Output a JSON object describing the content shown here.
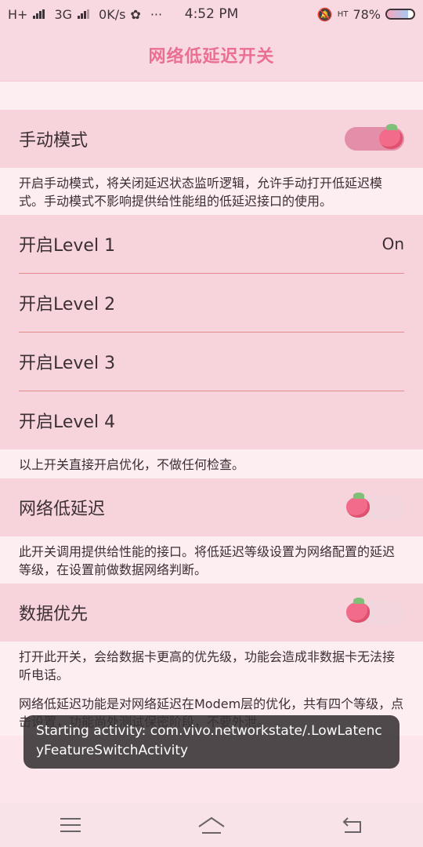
{
  "status": {
    "network": "H+",
    "network2": "3G",
    "speed": "0K/s",
    "more": "···",
    "time": "4:52 PM",
    "hd": "HT",
    "battery": "78%",
    "battery_level": 0.78
  },
  "title": "网络低延迟开关",
  "manual": {
    "label": "手动模式",
    "desc": "开启手动模式，将关闭延迟状态监听逻辑，允许手动打开低延迟模式。手动模式不影响提供给性能组的低延迟接口的使用。"
  },
  "levels": [
    {
      "label": "开启Level 1",
      "value": "On"
    },
    {
      "label": "开启Level 2",
      "value": ""
    },
    {
      "label": "开启Level 3",
      "value": ""
    },
    {
      "label": "开启Level 4",
      "value": ""
    }
  ],
  "levels_desc": "以上开关直接开启优化，不做任何检查。",
  "low_latency": {
    "label": "网络低延迟",
    "desc": "此开关调用提供给性能的接口。将低延迟等级设置为网络配置的延迟等级，在设置前做数据网络判断。"
  },
  "data_priority": {
    "label": "数据优先",
    "desc": "打开此开关，会给数据卡更高的优先级，功能会造成非数据卡无法接听电话。"
  },
  "footer_desc": "网络低延迟功能是对网络延迟在Modem层的优化，共有四个等级，点击设置，功能尚处测试保密阶段，不要外泄。",
  "toast": "Starting activity: com.vivo.networkstate/.LowLatencyFeatureSwitchActivity"
}
